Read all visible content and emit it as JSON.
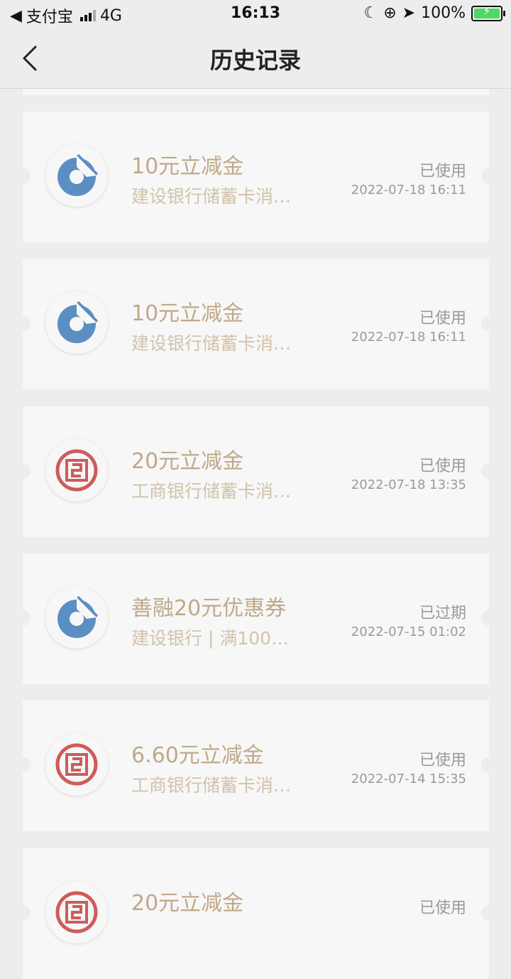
{
  "status_bar": {
    "back_app": "支付宝",
    "network": "4G",
    "time": "16:13",
    "battery": "100%"
  },
  "nav": {
    "title": "历史记录"
  },
  "records": [
    {
      "bank": "ccb",
      "title": "10元立减金",
      "subtitle": "建设银行储蓄卡消…",
      "status": "已使用",
      "date": "2022-07-18 16:11"
    },
    {
      "bank": "ccb",
      "title": "10元立减金",
      "subtitle": "建设银行储蓄卡消…",
      "status": "已使用",
      "date": "2022-07-18 16:11"
    },
    {
      "bank": "icbc",
      "title": "20元立减金",
      "subtitle": "工商银行储蓄卡消…",
      "status": "已使用",
      "date": "2022-07-18 13:35"
    },
    {
      "bank": "ccb",
      "title": "善融20元优惠券",
      "subtitle": "建设银行 | 满100…",
      "status": "已过期",
      "date": "2022-07-15 01:02"
    },
    {
      "bank": "icbc",
      "title": "6.60元立减金",
      "subtitle": "工商银行储蓄卡消…",
      "status": "已使用",
      "date": "2022-07-14 15:35"
    },
    {
      "bank": "icbc",
      "title": "20元立减金",
      "subtitle": "",
      "status": "已使用",
      "date": ""
    }
  ],
  "colors": {
    "ccb_blue": "#5b8fc3",
    "icbc_red": "#cf5b5b",
    "title_gold": "#bfa988"
  }
}
